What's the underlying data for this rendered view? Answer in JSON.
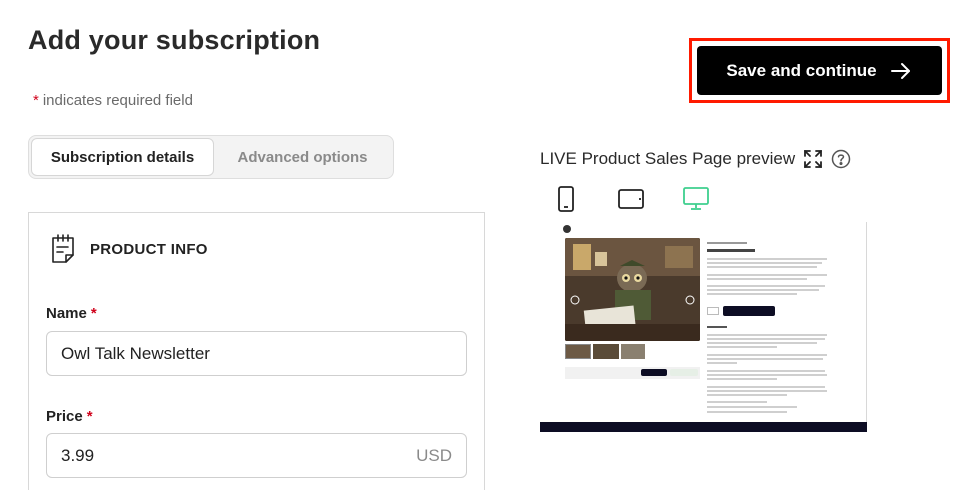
{
  "page": {
    "title": "Add your subscription",
    "required_note_star": "*",
    "required_note_text": "indicates required field"
  },
  "actions": {
    "save_label": "Save and continue"
  },
  "tabs": [
    {
      "label": "Subscription details",
      "active": true
    },
    {
      "label": "Advanced options",
      "active": false
    }
  ],
  "product_info": {
    "section_title": "PRODUCT INFO",
    "icon": "sticky-note-icon",
    "name_label": "Name",
    "name_value": "Owl Talk Newsletter",
    "price_label": "Price",
    "price_value": "3.99",
    "currency": "USD",
    "required_star": "*"
  },
  "preview": {
    "title": "LIVE Product Sales Page preview",
    "icons": [
      "expand-icon",
      "help-icon"
    ],
    "devices": [
      {
        "name": "mobile",
        "icon": "phone-icon",
        "active": false
      },
      {
        "name": "tablet",
        "icon": "tablet-icon",
        "active": false
      },
      {
        "name": "desktop",
        "icon": "desktop-icon",
        "active": true
      }
    ],
    "active_color": "#3ecf8e"
  },
  "colors": {
    "accent_border": "#ff1a00",
    "button_bg": "#000000",
    "required": "#d0021b"
  }
}
